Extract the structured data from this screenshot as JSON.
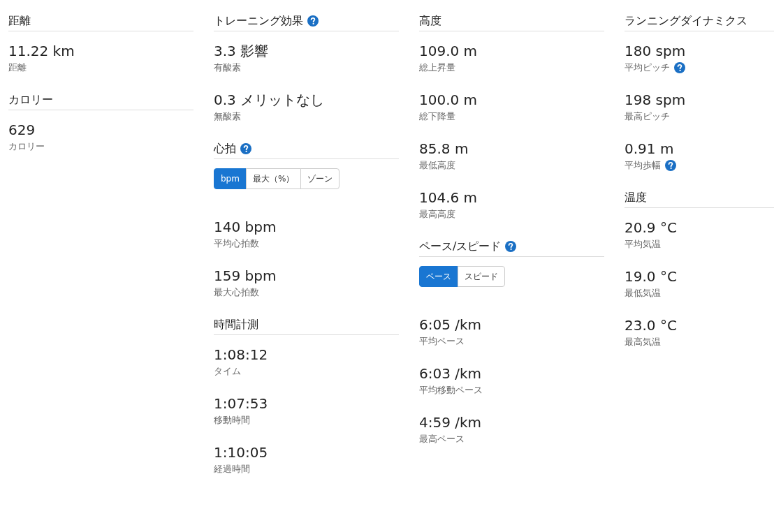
{
  "columns": [
    {
      "sections": [
        {
          "title": "距離",
          "help": false,
          "stats": [
            {
              "value": "11.22 km",
              "label": "距離",
              "help": false
            }
          ]
        },
        {
          "title": "カロリー",
          "help": false,
          "stats": [
            {
              "value": "629",
              "label": "カロリー",
              "help": false
            }
          ]
        }
      ]
    },
    {
      "sections": [
        {
          "title": "トレーニング効果",
          "help": true,
          "stats": [
            {
              "value": "3.3 影響",
              "label": "有酸素",
              "help": false
            },
            {
              "value": "0.3 メリットなし",
              "label": "無酸素",
              "help": false
            }
          ]
        },
        {
          "title": "心拍",
          "help": true,
          "toggle": [
            {
              "label": "bpm",
              "selected": true
            },
            {
              "label": "最大（%）",
              "selected": false
            },
            {
              "label": "ゾーン",
              "selected": false
            }
          ],
          "stats": [
            {
              "value": "140 bpm",
              "label": "平均心拍数",
              "help": false
            },
            {
              "value": "159 bpm",
              "label": "最大心拍数",
              "help": false
            }
          ]
        },
        {
          "title": "時間計測",
          "help": false,
          "stats": [
            {
              "value": "1:08:12",
              "label": "タイム",
              "help": false
            },
            {
              "value": "1:07:53",
              "label": "移動時間",
              "help": false
            },
            {
              "value": "1:10:05",
              "label": "経過時間",
              "help": false
            }
          ]
        }
      ]
    },
    {
      "sections": [
        {
          "title": "高度",
          "help": false,
          "stats": [
            {
              "value": "109.0 m",
              "label": "総上昇量",
              "help": false
            },
            {
              "value": "100.0 m",
              "label": "総下降量",
              "help": false
            },
            {
              "value": "85.8 m",
              "label": "最低高度",
              "help": false
            },
            {
              "value": "104.6 m",
              "label": "最高高度",
              "help": false
            }
          ]
        },
        {
          "title": "ペース/スピード",
          "help": true,
          "toggle": [
            {
              "label": "ペース",
              "selected": true
            },
            {
              "label": "スピード",
              "selected": false
            }
          ],
          "stats": [
            {
              "value": "6:05 /km",
              "label": "平均ペース",
              "help": false
            },
            {
              "value": "6:03 /km",
              "label": "平均移動ペース",
              "help": false
            },
            {
              "value": "4:59 /km",
              "label": "最高ペース",
              "help": false
            }
          ]
        }
      ]
    },
    {
      "sections": [
        {
          "title": "ランニングダイナミクス",
          "help": false,
          "stats": [
            {
              "value": "180 spm",
              "label": "平均ピッチ",
              "help": true
            },
            {
              "value": "198 spm",
              "label": "最高ピッチ",
              "help": false
            },
            {
              "value": "0.91 m",
              "label": "平均歩幅",
              "help": true
            }
          ]
        },
        {
          "title": "温度",
          "help": false,
          "stats": [
            {
              "value": "20.9 °C",
              "label": "平均気温",
              "help": false
            },
            {
              "value": "19.0 °C",
              "label": "最低気温",
              "help": false
            },
            {
              "value": "23.0 °C",
              "label": "最高気温",
              "help": false
            }
          ]
        }
      ]
    }
  ]
}
